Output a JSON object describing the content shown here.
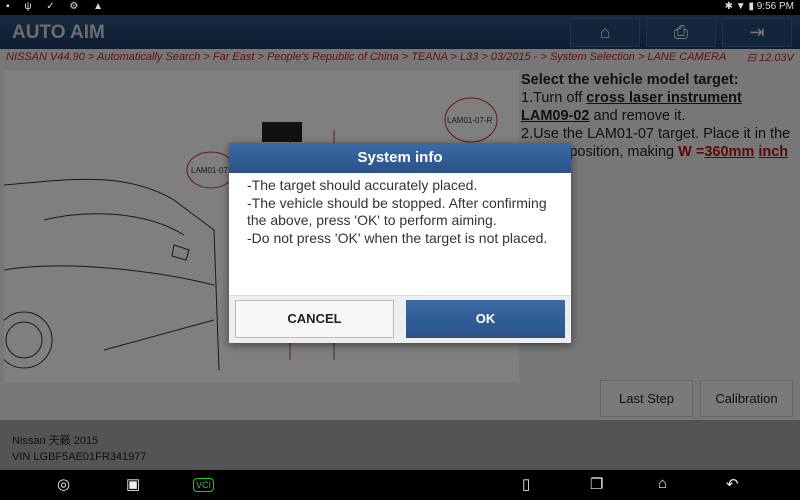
{
  "status_bar": {
    "time": "9:56 PM",
    "left_icons": [
      "image-icon",
      "usb-icon",
      "check-icon",
      "bug-icon",
      "warning-icon"
    ],
    "right_icons": [
      "bluetooth-icon",
      "wifi-icon",
      "battery-icon"
    ]
  },
  "header": {
    "title": "AUTO AIM",
    "buttons": [
      "home-icon",
      "print-icon",
      "exit-icon"
    ]
  },
  "breadcrumb": "NISSAN V44.90 > Automatically Search > Far East > People's Republic of China > TEANA > L33 > 03/2015 - > System Selection > LANE CAMERA",
  "voltage": "12.03V",
  "diagram": {
    "labels": [
      "LAM01-07",
      "LAM01-07-R"
    ]
  },
  "instructions": {
    "heading": "Select the vehicle model target:",
    "step1_prefix": "1.Turn off ",
    "step1_link": "cross laser instrument LAM09-02",
    "step1_suffix": " and remove it.",
    "step2_prefix": "2.Use the LAM01-07 target. Place it in the correct position, making ",
    "step2_w": "W =",
    "step2_value": "360mm",
    "step2_unit": "inch"
  },
  "buttons": {
    "last_step": "Last Step",
    "calibration": "Calibration"
  },
  "footer": {
    "vehicle": "Nissan 天籁 2015",
    "vin": "VIN LGBF5AE01FR341977"
  },
  "dialog": {
    "title": "System info",
    "lines": [
      "-The target should accurately placed.",
      "-The vehicle should be stopped. After confirming the above, press 'OK' to perform aiming.",
      "-Do not press 'OK' when the target is not placed."
    ],
    "cancel": "CANCEL",
    "ok": "OK"
  },
  "nav_bar": {
    "vci_label": "VCI"
  }
}
